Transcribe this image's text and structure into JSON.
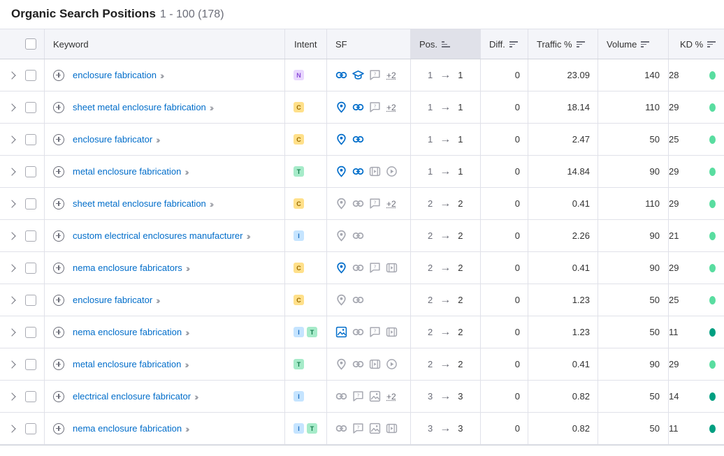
{
  "header": {
    "title": "Organic Search Positions",
    "range": "1 - 100 (178)"
  },
  "columns": {
    "keyword": "Keyword",
    "intent": "Intent",
    "sf": "SF",
    "pos": "Pos.",
    "diff": "Diff.",
    "traffic": "Traffic %",
    "volume": "Volume",
    "kd": "KD %"
  },
  "intent_colors": {
    "N": {
      "bg": "#e9d7fe",
      "fg": "#8a4bd8"
    },
    "C": {
      "bg": "#ffe08a",
      "fg": "#9a6a00"
    },
    "T": {
      "bg": "#a6ebc9",
      "fg": "#137a4b"
    },
    "I": {
      "bg": "#c5e4ff",
      "fg": "#1e6fc0"
    }
  },
  "kd_colors": {
    "easy": "#59dda0",
    "very_easy": "#009f81"
  },
  "rows": [
    {
      "keyword": "enclosure fabrication",
      "intents": [
        "N"
      ],
      "sf": [
        "link-icon-blue",
        "graduation-cap-icon-blue",
        "reviews-icon-gray"
      ],
      "sf_more": "+2",
      "pos_from": "1",
      "pos_to": "1",
      "diff": "0",
      "traffic": "23.09",
      "volume": "140",
      "kd": "28",
      "kd_level": "easy"
    },
    {
      "keyword": "sheet metal enclosure fabrication",
      "intents": [
        "C"
      ],
      "sf": [
        "location-pin-icon-blue",
        "link-icon-blue",
        "reviews-icon-gray"
      ],
      "sf_more": "+2",
      "pos_from": "1",
      "pos_to": "1",
      "diff": "0",
      "traffic": "18.14",
      "volume": "110",
      "kd": "29",
      "kd_level": "easy"
    },
    {
      "keyword": "enclosure fabricator",
      "intents": [
        "C"
      ],
      "sf": [
        "location-pin-icon-blue",
        "link-icon-blue"
      ],
      "sf_more": "",
      "pos_from": "1",
      "pos_to": "1",
      "diff": "0",
      "traffic": "2.47",
      "volume": "50",
      "kd": "25",
      "kd_level": "easy"
    },
    {
      "keyword": "metal enclosure fabrication",
      "intents": [
        "T"
      ],
      "sf": [
        "location-pin-icon-blue",
        "link-icon-blue",
        "video-icon-gray",
        "play-icon-gray"
      ],
      "sf_more": "",
      "pos_from": "1",
      "pos_to": "1",
      "diff": "0",
      "traffic": "14.84",
      "volume": "90",
      "kd": "29",
      "kd_level": "easy"
    },
    {
      "keyword": "sheet metal enclosure fabrication",
      "intents": [
        "C"
      ],
      "sf": [
        "location-pin-icon-gray",
        "link-icon-gray",
        "reviews-icon-gray"
      ],
      "sf_more": "+2",
      "pos_from": "2",
      "pos_to": "2",
      "diff": "0",
      "traffic": "0.41",
      "volume": "110",
      "kd": "29",
      "kd_level": "easy"
    },
    {
      "keyword": "custom electrical enclosures manufacturer",
      "intents": [
        "I"
      ],
      "sf": [
        "location-pin-icon-gray",
        "link-icon-gray"
      ],
      "sf_more": "",
      "pos_from": "2",
      "pos_to": "2",
      "diff": "0",
      "traffic": "2.26",
      "volume": "90",
      "kd": "21",
      "kd_level": "easy"
    },
    {
      "keyword": "nema enclosure fabricators",
      "intents": [
        "C"
      ],
      "sf": [
        "location-pin-icon-blue",
        "link-icon-gray",
        "reviews-icon-gray",
        "video-icon-gray"
      ],
      "sf_more": "",
      "pos_from": "2",
      "pos_to": "2",
      "diff": "0",
      "traffic": "0.41",
      "volume": "90",
      "kd": "29",
      "kd_level": "easy"
    },
    {
      "keyword": "enclosure fabricator",
      "intents": [
        "C"
      ],
      "sf": [
        "location-pin-icon-gray",
        "link-icon-gray"
      ],
      "sf_more": "",
      "pos_from": "2",
      "pos_to": "2",
      "diff": "0",
      "traffic": "1.23",
      "volume": "50",
      "kd": "25",
      "kd_level": "easy"
    },
    {
      "keyword": "nema enclosure fabrication",
      "intents": [
        "I",
        "T"
      ],
      "sf": [
        "image-icon-blue",
        "link-icon-gray",
        "reviews-icon-gray",
        "video-icon-gray"
      ],
      "sf_more": "",
      "pos_from": "2",
      "pos_to": "2",
      "diff": "0",
      "traffic": "1.23",
      "volume": "50",
      "kd": "11",
      "kd_level": "very_easy"
    },
    {
      "keyword": "metal enclosure fabrication",
      "intents": [
        "T"
      ],
      "sf": [
        "location-pin-icon-gray",
        "link-icon-gray",
        "video-icon-gray",
        "play-icon-gray"
      ],
      "sf_more": "",
      "pos_from": "2",
      "pos_to": "2",
      "diff": "0",
      "traffic": "0.41",
      "volume": "90",
      "kd": "29",
      "kd_level": "easy"
    },
    {
      "keyword": "electrical enclosure fabricator",
      "intents": [
        "I"
      ],
      "sf": [
        "link-icon-gray",
        "reviews-icon-gray",
        "image-icon-gray"
      ],
      "sf_more": "+2",
      "pos_from": "3",
      "pos_to": "3",
      "diff": "0",
      "traffic": "0.82",
      "volume": "50",
      "kd": "14",
      "kd_level": "very_easy"
    },
    {
      "keyword": "nema enclosure fabrication",
      "intents": [
        "I",
        "T"
      ],
      "sf": [
        "link-icon-gray",
        "reviews-icon-gray",
        "image-icon-gray",
        "video-icon-gray"
      ],
      "sf_more": "",
      "pos_from": "3",
      "pos_to": "3",
      "diff": "0",
      "traffic": "0.82",
      "volume": "50",
      "kd": "11",
      "kd_level": "very_easy"
    }
  ]
}
